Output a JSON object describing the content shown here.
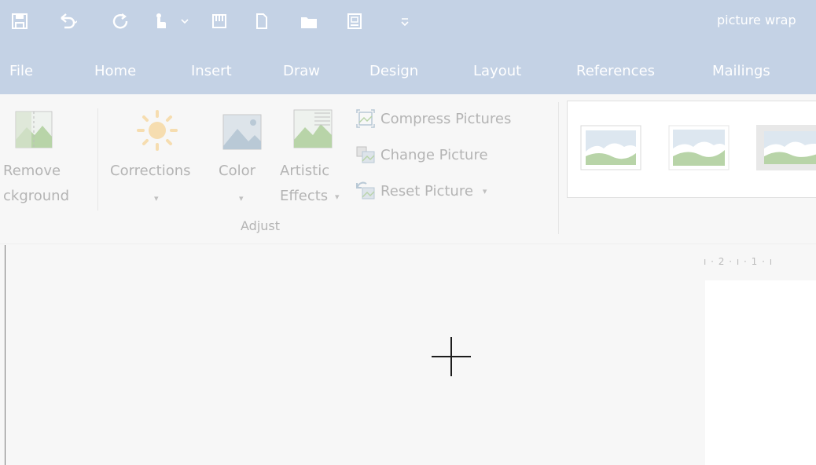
{
  "window": {
    "title": "picture wrap"
  },
  "quick_access": [
    "save-icon",
    "undo-icon",
    "redo-icon",
    "touch-mode-icon",
    "paste-icon",
    "new-document-icon",
    "open-folder-icon",
    "print-preview-icon",
    "customize-qat-icon"
  ],
  "menu": {
    "file": "File",
    "home": "Home",
    "insert": "Insert",
    "draw": "Draw",
    "design": "Design",
    "layout": "Layout",
    "references": "References",
    "mailings": "Mailings"
  },
  "ribbon": {
    "remove_background": {
      "line1": "Remove",
      "line2": "ckground"
    },
    "corrections": {
      "label": "Corrections",
      "arrow": "▾"
    },
    "color": {
      "label": "Color",
      "arrow": "▾"
    },
    "artistic_effects": {
      "line1": "Artistic",
      "line2": "Effects",
      "arrow": "▾"
    },
    "compress": "Compress Pictures",
    "change": "Change Picture",
    "reset": {
      "label": "Reset Picture",
      "arrow": "▾"
    },
    "adjust_group": "Adjust"
  },
  "ruler": {
    "text": "ı · 2 · ı · 1 · ı"
  },
  "colors": {
    "titlebar": "#c4d2e5",
    "ribbon_bg": "#f7f7f7",
    "disabled_text": "#b4b4b4",
    "accent": "#b8d4a8"
  }
}
